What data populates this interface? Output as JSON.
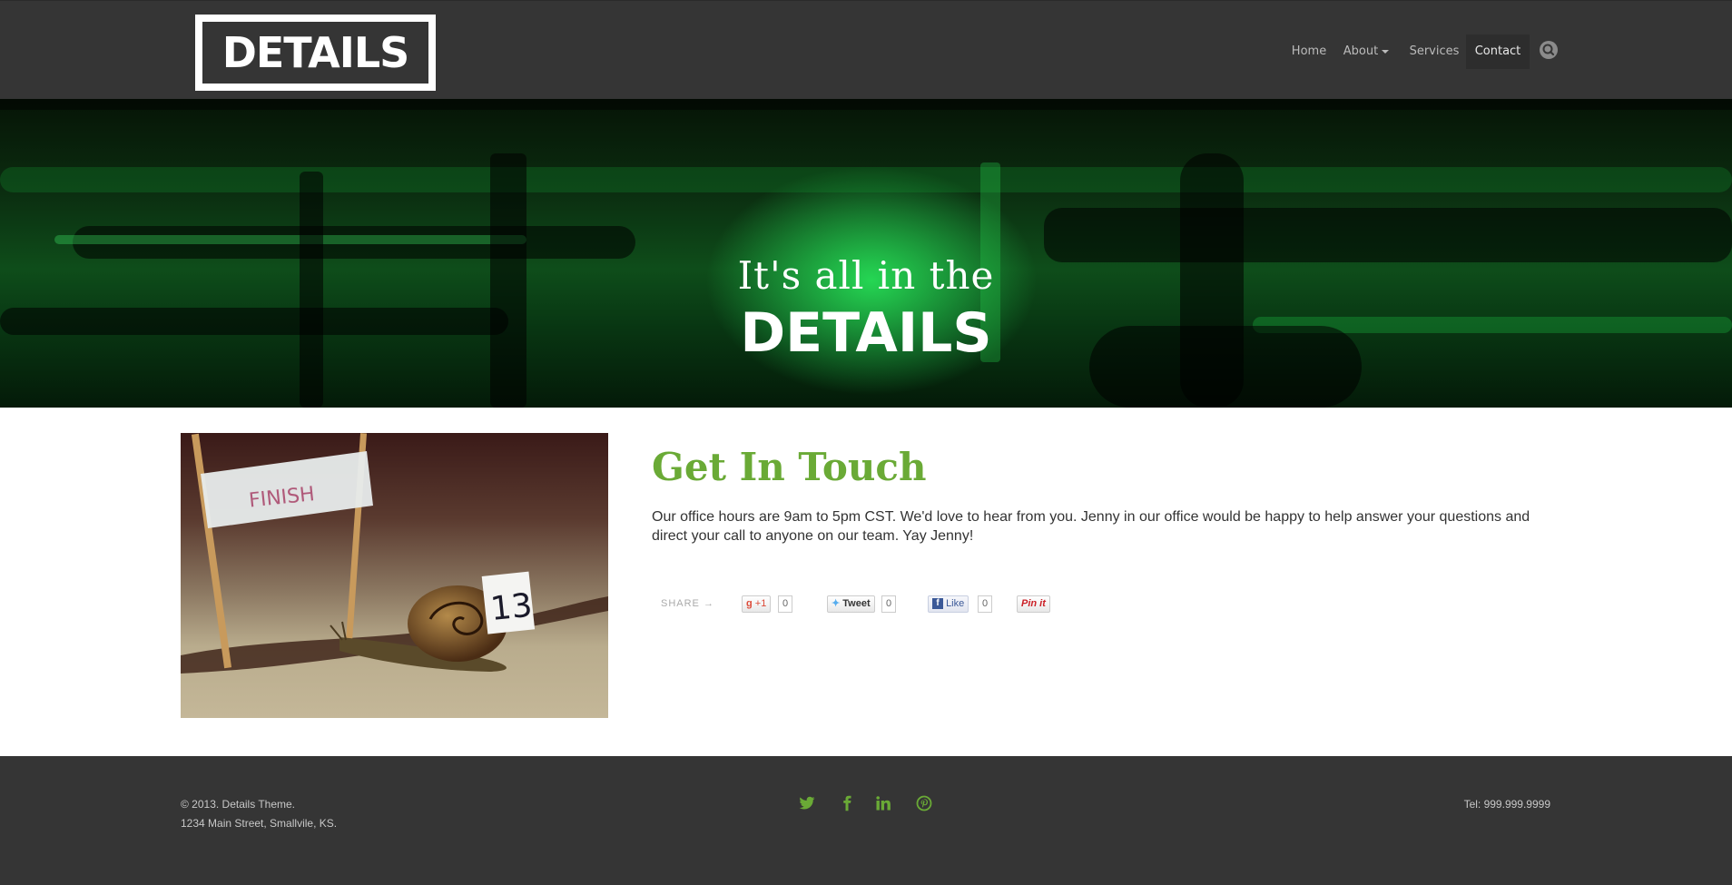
{
  "brand": {
    "logo_text": "DETAILS"
  },
  "nav": {
    "items": [
      {
        "label": "Home"
      },
      {
        "label": "About"
      },
      {
        "label": "Services"
      },
      {
        "label": "Contact"
      }
    ]
  },
  "hero": {
    "line1": "It's all in the",
    "line2": "DETAILS"
  },
  "content": {
    "title": "Get In Touch",
    "body": "Our office hours are 9am to 5pm CST. We'd love to hear from you. Jenny in our office would be happy to help answer your questions and direct your call to anyone on our team. Yay Jenny!",
    "photo_flag_text": "FINISH",
    "photo_tag_number": "13"
  },
  "share": {
    "label": "SHARE →",
    "gplus_label": "+1",
    "gplus_count": "0",
    "tweet_label": "Tweet",
    "tweet_count": "0",
    "like_label": "Like",
    "like_count": "0",
    "pin_label": "Pin it"
  },
  "footer": {
    "copyright": "© 2013. Details Theme.",
    "address": "1234 Main Street, Smallvile, KS.",
    "phone": "Tel: 999.999.9999",
    "social_icons": [
      "twitter-icon",
      "facebook-icon",
      "linkedin-icon",
      "pinterest-icon"
    ]
  },
  "colors": {
    "accent": "#6aaa36",
    "header_bg": "#353535",
    "hero_green": "#1fd055"
  }
}
